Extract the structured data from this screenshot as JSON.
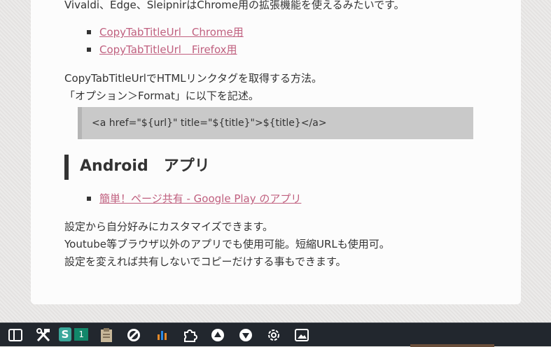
{
  "article": {
    "intro": "Vivaldi、Edge、SleipnirはChrome用の拡張機能を使えるみたいです。",
    "extension_links": [
      "CopyTabTitleUrl　Chrome用",
      "CopyTabTitleUrl　Firefox用"
    ],
    "howto_line1": "CopyTabTitleUrlでHTMLリンクタグを取得する方法。",
    "howto_line2": "「オプション＞Format」に以下を記述。",
    "code": "<a href=\"${url}\" title=\"${title}\">${title}</a>",
    "android_heading": "Android　アプリ",
    "android_links": [
      "簡単！ページ共有 - Google Play のアプリ"
    ],
    "outro_line1": "設定から自分好みにカスタマイズできます。",
    "outro_line2": "Youtube等ブラウザ以外のアプリでも使用可能。短縮URLも使用可。",
    "outro_line3": "設定を変えれば共有しないでコピーだけする事もできます。"
  },
  "taskbar": {
    "badge_s": "S",
    "badge_count": "1",
    "icons": [
      "panel-toggle-icon",
      "tools-icon",
      "s-extension-icon",
      "clipboard-icon",
      "block-icon",
      "sound-bars-icon",
      "extensions-puzzle-icon",
      "scroll-up-icon",
      "scroll-down-icon",
      "settings-gear-icon",
      "image-icon"
    ]
  },
  "colors": {
    "link": "#c0607f",
    "taskbar": "#22272e",
    "code_bg": "#c9c9c9",
    "badge_teal": "#3aa79a"
  }
}
